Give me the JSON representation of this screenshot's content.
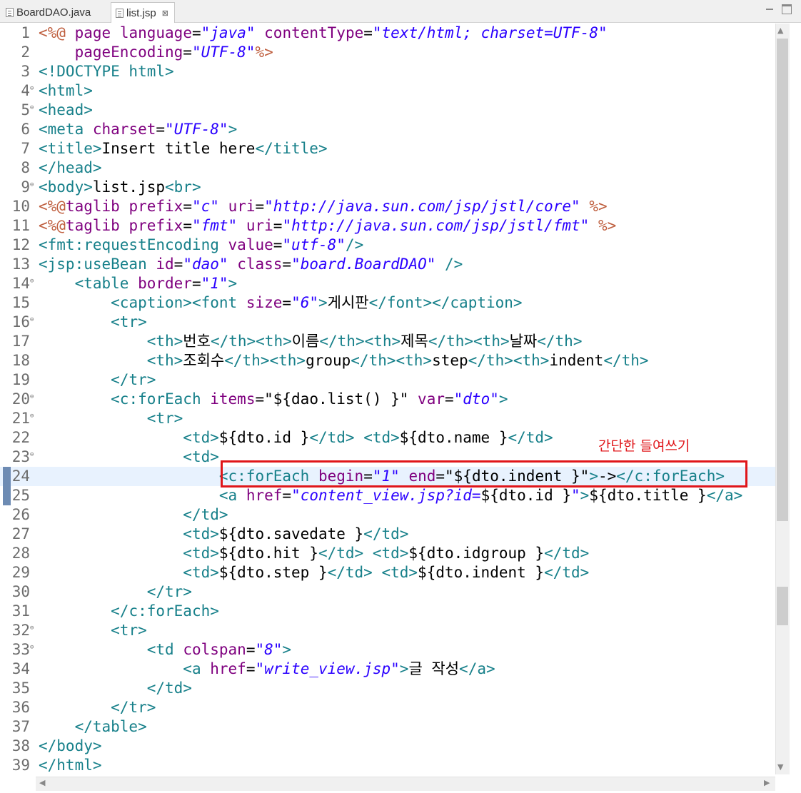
{
  "tabs": [
    {
      "label": "BoardDAO.java",
      "active": false,
      "icon": "java-file-icon"
    },
    {
      "label": "list.jsp",
      "active": true,
      "icon": "jsp-file-icon",
      "close": "⊠"
    }
  ],
  "annotation": "간단한 들여쓰기",
  "colors": {
    "tag": "#17808a",
    "attr": "#7f007f",
    "string": "#2a00ff",
    "directive": "#bf5f3f",
    "text": "#000000",
    "highlight": "#e0161a"
  },
  "current_line": 24,
  "highlighted_line": 24,
  "lines": [
    {
      "n": "1",
      "fold": false,
      "tokens": [
        {
          "k": "d",
          "t": "<%@"
        },
        {
          "k": "x",
          "t": " "
        },
        {
          "k": "a",
          "t": "page"
        },
        {
          "k": "x",
          "t": " "
        },
        {
          "k": "a",
          "t": "language"
        },
        {
          "k": "x",
          "t": "="
        },
        {
          "k": "s",
          "t": "\"java\""
        },
        {
          "k": "x",
          "t": " "
        },
        {
          "k": "a",
          "t": "contentType"
        },
        {
          "k": "x",
          "t": "="
        },
        {
          "k": "s",
          "t": "\"text/html; charset=UTF-8\""
        }
      ]
    },
    {
      "n": "2",
      "fold": false,
      "tokens": [
        {
          "k": "x",
          "t": "    "
        },
        {
          "k": "a",
          "t": "pageEncoding"
        },
        {
          "k": "x",
          "t": "="
        },
        {
          "k": "s",
          "t": "\"UTF-8\""
        },
        {
          "k": "d",
          "t": "%>"
        }
      ]
    },
    {
      "n": "3",
      "fold": false,
      "tokens": [
        {
          "k": "g",
          "t": "<!DOCTYPE html>"
        }
      ]
    },
    {
      "n": "4",
      "fold": true,
      "tokens": [
        {
          "k": "g",
          "t": "<html>"
        }
      ]
    },
    {
      "n": "5",
      "fold": true,
      "tokens": [
        {
          "k": "g",
          "t": "<head>"
        }
      ]
    },
    {
      "n": "6",
      "fold": false,
      "tokens": [
        {
          "k": "g",
          "t": "<meta"
        },
        {
          "k": "x",
          "t": " "
        },
        {
          "k": "a",
          "t": "charset"
        },
        {
          "k": "x",
          "t": "="
        },
        {
          "k": "s",
          "t": "\"UTF-8\""
        },
        {
          "k": "g",
          "t": ">"
        }
      ]
    },
    {
      "n": "7",
      "fold": false,
      "tokens": [
        {
          "k": "g",
          "t": "<title>"
        },
        {
          "k": "x",
          "t": "Insert title here"
        },
        {
          "k": "g",
          "t": "</title>"
        }
      ]
    },
    {
      "n": "8",
      "fold": false,
      "tokens": [
        {
          "k": "g",
          "t": "</head>"
        }
      ]
    },
    {
      "n": "9",
      "fold": true,
      "tokens": [
        {
          "k": "g",
          "t": "<body>"
        },
        {
          "k": "x",
          "t": "list.jsp"
        },
        {
          "k": "g",
          "t": "<br>"
        }
      ]
    },
    {
      "n": "10",
      "fold": false,
      "tokens": [
        {
          "k": "d",
          "t": "<%@"
        },
        {
          "k": "a",
          "t": "taglib"
        },
        {
          "k": "x",
          "t": " "
        },
        {
          "k": "a",
          "t": "prefix"
        },
        {
          "k": "x",
          "t": "="
        },
        {
          "k": "s",
          "t": "\"c\""
        },
        {
          "k": "x",
          "t": " "
        },
        {
          "k": "a",
          "t": "uri"
        },
        {
          "k": "x",
          "t": "="
        },
        {
          "k": "s",
          "t": "\"http://java.sun.com/jsp/jstl/core\""
        },
        {
          "k": "x",
          "t": " "
        },
        {
          "k": "d",
          "t": "%>"
        }
      ]
    },
    {
      "n": "11",
      "fold": false,
      "tokens": [
        {
          "k": "d",
          "t": "<%@"
        },
        {
          "k": "a",
          "t": "taglib"
        },
        {
          "k": "x",
          "t": " "
        },
        {
          "k": "a",
          "t": "prefix"
        },
        {
          "k": "x",
          "t": "="
        },
        {
          "k": "s",
          "t": "\"fmt\""
        },
        {
          "k": "x",
          "t": " "
        },
        {
          "k": "a",
          "t": "uri"
        },
        {
          "k": "x",
          "t": "="
        },
        {
          "k": "s",
          "t": "\"http://java.sun.com/jsp/jstl/fmt\""
        },
        {
          "k": "x",
          "t": " "
        },
        {
          "k": "d",
          "t": "%>"
        }
      ]
    },
    {
      "n": "12",
      "fold": false,
      "tokens": [
        {
          "k": "g",
          "t": "<fmt:requestEncoding"
        },
        {
          "k": "x",
          "t": " "
        },
        {
          "k": "a",
          "t": "value"
        },
        {
          "k": "x",
          "t": "="
        },
        {
          "k": "s",
          "t": "\"utf-8\""
        },
        {
          "k": "g",
          "t": "/>"
        }
      ]
    },
    {
      "n": "13",
      "fold": false,
      "tokens": [
        {
          "k": "g",
          "t": "<jsp:useBean"
        },
        {
          "k": "x",
          "t": " "
        },
        {
          "k": "a",
          "t": "id"
        },
        {
          "k": "x",
          "t": "="
        },
        {
          "k": "s",
          "t": "\"dao\""
        },
        {
          "k": "x",
          "t": " "
        },
        {
          "k": "a",
          "t": "class"
        },
        {
          "k": "x",
          "t": "="
        },
        {
          "k": "s",
          "t": "\"board.BoardDAO\""
        },
        {
          "k": "x",
          "t": " "
        },
        {
          "k": "g",
          "t": "/>"
        }
      ]
    },
    {
      "n": "14",
      "fold": true,
      "tokens": [
        {
          "k": "x",
          "t": "    "
        },
        {
          "k": "g",
          "t": "<table"
        },
        {
          "k": "x",
          "t": " "
        },
        {
          "k": "a",
          "t": "border"
        },
        {
          "k": "x",
          "t": "="
        },
        {
          "k": "s",
          "t": "\"1\""
        },
        {
          "k": "g",
          "t": ">"
        }
      ]
    },
    {
      "n": "15",
      "fold": false,
      "tokens": [
        {
          "k": "x",
          "t": "        "
        },
        {
          "k": "g",
          "t": "<caption><font"
        },
        {
          "k": "x",
          "t": " "
        },
        {
          "k": "a",
          "t": "size"
        },
        {
          "k": "x",
          "t": "="
        },
        {
          "k": "s",
          "t": "\"6\""
        },
        {
          "k": "g",
          "t": ">"
        },
        {
          "k": "x",
          "t": "게시판"
        },
        {
          "k": "g",
          "t": "</font></caption>"
        }
      ]
    },
    {
      "n": "16",
      "fold": true,
      "tokens": [
        {
          "k": "x",
          "t": "        "
        },
        {
          "k": "g",
          "t": "<tr>"
        }
      ]
    },
    {
      "n": "17",
      "fold": false,
      "tokens": [
        {
          "k": "x",
          "t": "            "
        },
        {
          "k": "g",
          "t": "<th>"
        },
        {
          "k": "x",
          "t": "번호"
        },
        {
          "k": "g",
          "t": "</th><th>"
        },
        {
          "k": "x",
          "t": "이름"
        },
        {
          "k": "g",
          "t": "</th><th>"
        },
        {
          "k": "x",
          "t": "제목"
        },
        {
          "k": "g",
          "t": "</th><th>"
        },
        {
          "k": "x",
          "t": "날짜"
        },
        {
          "k": "g",
          "t": "</th>"
        }
      ]
    },
    {
      "n": "18",
      "fold": false,
      "tokens": [
        {
          "k": "x",
          "t": "            "
        },
        {
          "k": "g",
          "t": "<th>"
        },
        {
          "k": "x",
          "t": "조회수"
        },
        {
          "k": "g",
          "t": "</th><th>"
        },
        {
          "k": "x",
          "t": "group"
        },
        {
          "k": "g",
          "t": "</th><th>"
        },
        {
          "k": "x",
          "t": "step"
        },
        {
          "k": "g",
          "t": "</th><th>"
        },
        {
          "k": "x",
          "t": "indent"
        },
        {
          "k": "g",
          "t": "</th>"
        }
      ]
    },
    {
      "n": "19",
      "fold": false,
      "tokens": [
        {
          "k": "x",
          "t": "        "
        },
        {
          "k": "g",
          "t": "</tr>"
        }
      ]
    },
    {
      "n": "20",
      "fold": true,
      "tokens": [
        {
          "k": "x",
          "t": "        "
        },
        {
          "k": "g",
          "t": "<c:forEach"
        },
        {
          "k": "x",
          "t": " "
        },
        {
          "k": "a",
          "t": "items"
        },
        {
          "k": "x",
          "t": "=\"${dao.list() }\" "
        },
        {
          "k": "a",
          "t": "var"
        },
        {
          "k": "x",
          "t": "="
        },
        {
          "k": "s",
          "t": "\"dto\""
        },
        {
          "k": "g",
          "t": ">"
        }
      ]
    },
    {
      "n": "21",
      "fold": true,
      "tokens": [
        {
          "k": "x",
          "t": "            "
        },
        {
          "k": "g",
          "t": "<tr>"
        }
      ]
    },
    {
      "n": "22",
      "fold": false,
      "tokens": [
        {
          "k": "x",
          "t": "                "
        },
        {
          "k": "g",
          "t": "<td>"
        },
        {
          "k": "x",
          "t": "${dto.id }"
        },
        {
          "k": "g",
          "t": "</td>"
        },
        {
          "k": "x",
          "t": " "
        },
        {
          "k": "g",
          "t": "<td>"
        },
        {
          "k": "x",
          "t": "${dto.name }"
        },
        {
          "k": "g",
          "t": "</td>"
        }
      ]
    },
    {
      "n": "23",
      "fold": true,
      "tokens": [
        {
          "k": "x",
          "t": "                "
        },
        {
          "k": "g",
          "t": "<td>"
        }
      ]
    },
    {
      "n": "24",
      "fold": false,
      "tokens": [
        {
          "k": "x",
          "t": "                    "
        },
        {
          "k": "g",
          "t": "<c:forEach"
        },
        {
          "k": "x",
          "t": " "
        },
        {
          "k": "a",
          "t": "begin"
        },
        {
          "k": "x",
          "t": "="
        },
        {
          "k": "s",
          "t": "\"1\""
        },
        {
          "k": "x",
          "t": " "
        },
        {
          "k": "a",
          "t": "end"
        },
        {
          "k": "x",
          "t": "=\"${dto.indent }\""
        },
        {
          "k": "g",
          "t": ">"
        },
        {
          "k": "x",
          "t": "->"
        },
        {
          "k": "g",
          "t": "</c:forEach>"
        }
      ]
    },
    {
      "n": "25",
      "fold": false,
      "tokens": [
        {
          "k": "x",
          "t": "                    "
        },
        {
          "k": "g",
          "t": "<a"
        },
        {
          "k": "x",
          "t": " "
        },
        {
          "k": "a",
          "t": "href"
        },
        {
          "k": "x",
          "t": "="
        },
        {
          "k": "s",
          "t": "\"content_view.jsp?id="
        },
        {
          "k": "x",
          "t": "${dto.id }"
        },
        {
          "k": "s",
          "t": "\""
        },
        {
          "k": "g",
          "t": ">"
        },
        {
          "k": "x",
          "t": "${dto.title }"
        },
        {
          "k": "g",
          "t": "</a>"
        }
      ]
    },
    {
      "n": "26",
      "fold": false,
      "tokens": [
        {
          "k": "x",
          "t": "                "
        },
        {
          "k": "g",
          "t": "</td>"
        }
      ]
    },
    {
      "n": "27",
      "fold": false,
      "tokens": [
        {
          "k": "x",
          "t": "                "
        },
        {
          "k": "g",
          "t": "<td>"
        },
        {
          "k": "x",
          "t": "${dto.savedate }"
        },
        {
          "k": "g",
          "t": "</td>"
        }
      ]
    },
    {
      "n": "28",
      "fold": false,
      "tokens": [
        {
          "k": "x",
          "t": "                "
        },
        {
          "k": "g",
          "t": "<td>"
        },
        {
          "k": "x",
          "t": "${dto.hit }"
        },
        {
          "k": "g",
          "t": "</td>"
        },
        {
          "k": "x",
          "t": " "
        },
        {
          "k": "g",
          "t": "<td>"
        },
        {
          "k": "x",
          "t": "${dto.idgroup }"
        },
        {
          "k": "g",
          "t": "</td>"
        }
      ]
    },
    {
      "n": "29",
      "fold": false,
      "tokens": [
        {
          "k": "x",
          "t": "                "
        },
        {
          "k": "g",
          "t": "<td>"
        },
        {
          "k": "x",
          "t": "${dto.step }"
        },
        {
          "k": "g",
          "t": "</td>"
        },
        {
          "k": "x",
          "t": " "
        },
        {
          "k": "g",
          "t": "<td>"
        },
        {
          "k": "x",
          "t": "${dto.indent }"
        },
        {
          "k": "g",
          "t": "</td>"
        }
      ]
    },
    {
      "n": "30",
      "fold": false,
      "tokens": [
        {
          "k": "x",
          "t": "            "
        },
        {
          "k": "g",
          "t": "</tr>"
        }
      ]
    },
    {
      "n": "31",
      "fold": false,
      "tokens": [
        {
          "k": "x",
          "t": "        "
        },
        {
          "k": "g",
          "t": "</c:forEach>"
        }
      ]
    },
    {
      "n": "32",
      "fold": true,
      "tokens": [
        {
          "k": "x",
          "t": "        "
        },
        {
          "k": "g",
          "t": "<tr>"
        }
      ]
    },
    {
      "n": "33",
      "fold": true,
      "tokens": [
        {
          "k": "x",
          "t": "            "
        },
        {
          "k": "g",
          "t": "<td"
        },
        {
          "k": "x",
          "t": " "
        },
        {
          "k": "a",
          "t": "colspan"
        },
        {
          "k": "x",
          "t": "="
        },
        {
          "k": "s",
          "t": "\"8\""
        },
        {
          "k": "g",
          "t": ">"
        }
      ]
    },
    {
      "n": "34",
      "fold": false,
      "tokens": [
        {
          "k": "x",
          "t": "                "
        },
        {
          "k": "g",
          "t": "<a"
        },
        {
          "k": "x",
          "t": " "
        },
        {
          "k": "a",
          "t": "href"
        },
        {
          "k": "x",
          "t": "="
        },
        {
          "k": "s",
          "t": "\"write_view.jsp\""
        },
        {
          "k": "g",
          "t": ">"
        },
        {
          "k": "x",
          "t": "글 작성"
        },
        {
          "k": "g",
          "t": "</a>"
        }
      ]
    },
    {
      "n": "35",
      "fold": false,
      "tokens": [
        {
          "k": "x",
          "t": "            "
        },
        {
          "k": "g",
          "t": "</td>"
        }
      ]
    },
    {
      "n": "36",
      "fold": false,
      "tokens": [
        {
          "k": "x",
          "t": "        "
        },
        {
          "k": "g",
          "t": "</tr>"
        }
      ]
    },
    {
      "n": "37",
      "fold": false,
      "tokens": [
        {
          "k": "x",
          "t": "    "
        },
        {
          "k": "g",
          "t": "</table>"
        }
      ]
    },
    {
      "n": "38",
      "fold": false,
      "tokens": [
        {
          "k": "g",
          "t": "</body>"
        }
      ]
    },
    {
      "n": "39",
      "fold": false,
      "tokens": [
        {
          "k": "g",
          "t": "</html>"
        }
      ]
    }
  ]
}
